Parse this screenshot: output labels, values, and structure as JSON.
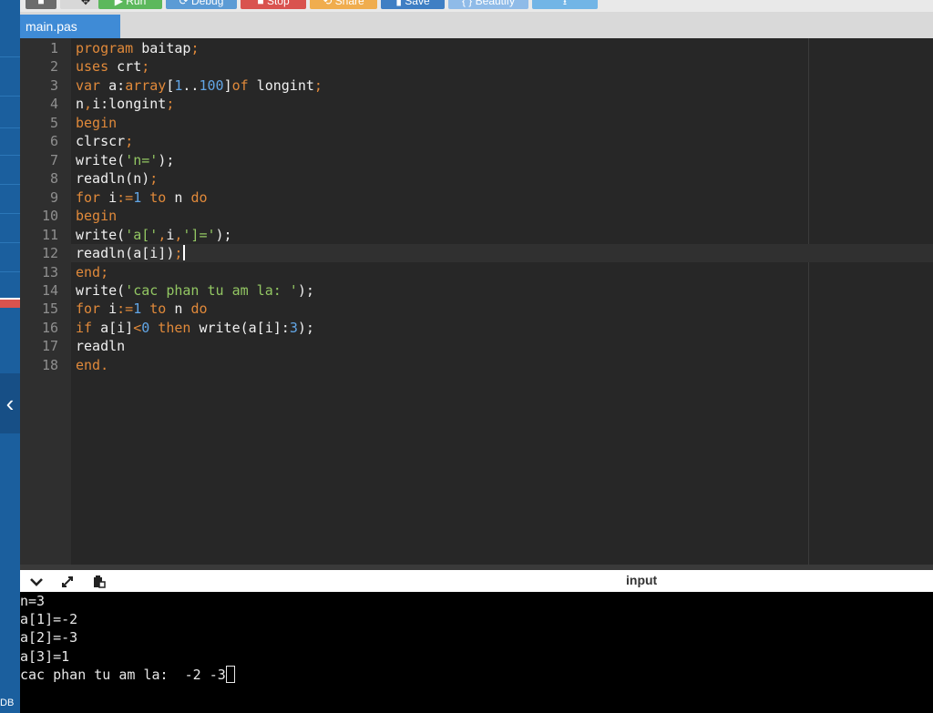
{
  "toolbar": {
    "buttons": [
      {
        "label": "■",
        "color": "#6c6c6c"
      },
      {
        "label": "✥",
        "color": "#d8d8d8"
      },
      {
        "label": "▶ Run",
        "color": "#5cb85c"
      },
      {
        "label": "⟳ Debug",
        "color": "#5b9bd5"
      },
      {
        "label": "■ Stop",
        "color": "#d9534f"
      },
      {
        "label": "⟲ Share",
        "color": "#f0ad4e"
      },
      {
        "label": "▮ Save",
        "color": "#3f7fc4"
      },
      {
        "label": "{ } Beautify",
        "color": "#8fbbe8"
      },
      {
        "label": "⭳",
        "color": "#72b5e6"
      }
    ]
  },
  "tabs": {
    "main": "main.pas"
  },
  "editor": {
    "line_numbers": [
      "1",
      "2",
      "3",
      "4",
      "5",
      "6",
      "7",
      "8",
      "9",
      "10",
      "11",
      "12",
      "13",
      "14",
      "15",
      "16",
      "17",
      "18"
    ],
    "tokens": {
      "l1": [
        "program",
        " baitap",
        ";"
      ],
      "l2": [
        "uses",
        " crt",
        ";"
      ],
      "l3": [
        "var",
        " a:",
        "array",
        "[",
        "1",
        "..",
        "100",
        "]",
        "of",
        " longint",
        ";"
      ],
      "l4": [
        "n",
        ",",
        "i:longint",
        ";"
      ],
      "l5": [
        "begin"
      ],
      "l6": [
        "clrscr",
        ";"
      ],
      "l7": [
        "write(",
        "'n='",
        ");"
      ],
      "l8": [
        "readln(n)",
        ";"
      ],
      "l9": [
        "for",
        " i",
        ":=",
        "1",
        " to",
        " n ",
        "do"
      ],
      "l10": [
        "begin"
      ],
      "l11": [
        "write(",
        "'a['",
        ",",
        "i",
        ",",
        "']='",
        ");"
      ],
      "l12": [
        "readln(a[i])",
        ";"
      ],
      "l13": [
        "end",
        ";"
      ],
      "l14": [
        "write(",
        "'cac phan tu am la: '",
        ");"
      ],
      "l15": [
        "for",
        " i",
        ":=",
        "1",
        " to",
        " n ",
        "do"
      ],
      "l16": [
        "if",
        " a[i]",
        "<",
        "0",
        " then",
        " write(a[i]:",
        "3",
        ");"
      ],
      "l17": [
        "readln"
      ],
      "l18": [
        "end",
        "."
      ]
    }
  },
  "console": {
    "header_label": "input",
    "lines": [
      "n=3",
      "a[1]=-2",
      "a[2]=-3",
      "a[3]=1",
      "cac phan tu am la:  -2 -3"
    ]
  },
  "sidebar": {
    "bottom_label": "DB"
  },
  "colors": {
    "keyword": "#e0893a",
    "number": "#62a6e6",
    "string": "#93c763",
    "sidebar": "#1b5f9e",
    "tab_active": "#3f8bd6"
  }
}
